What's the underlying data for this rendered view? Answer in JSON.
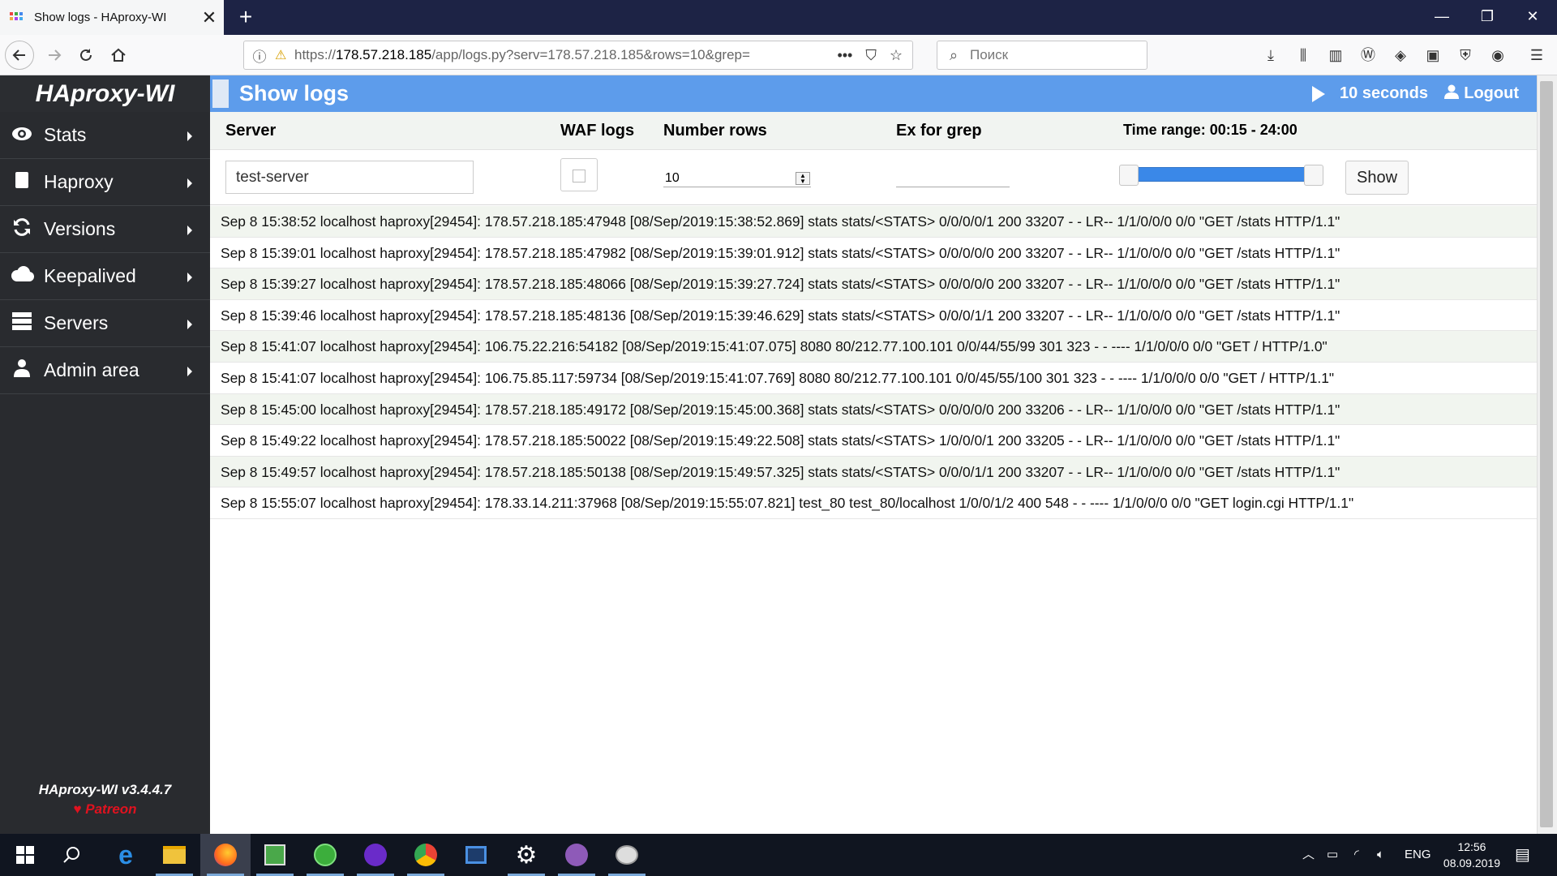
{
  "browser": {
    "tab_title": "Show logs - HAproxy-WI",
    "tab_close": "✕",
    "new_tab": "+",
    "url_prefix": "https://",
    "url_host": "178.57.218.185",
    "url_path": "/app/logs.py?serv=178.57.218.185&rows=10&grep=",
    "search_placeholder": "Поиск",
    "window_controls": {
      "minimize": "—",
      "restore": "❐",
      "close": "✕"
    }
  },
  "sidebar": {
    "logo": "HAproxy-WI",
    "items": [
      {
        "label": "Stats",
        "icon": "eye-icon"
      },
      {
        "label": "Haproxy",
        "icon": "file-icon"
      },
      {
        "label": "Versions",
        "icon": "refresh-icon"
      },
      {
        "label": "Keepalived",
        "icon": "cloud-icon"
      },
      {
        "label": "Servers",
        "icon": "server-icon"
      },
      {
        "label": "Admin area",
        "icon": "users-icon"
      }
    ],
    "version": "HAproxy-WI v3.4.4.7",
    "patreon": "Patreon"
  },
  "header": {
    "title": "Show logs",
    "refresh": "10 seconds",
    "logout": "Logout"
  },
  "filters": {
    "server_label": "Server",
    "waf_label": "WAF logs",
    "rows_label": "Number rows",
    "grep_label": "Ex for grep",
    "time_range_label": "Time range: 00:15 - 24:00",
    "server_value": "test-server",
    "rows_value": "10",
    "grep_value": "",
    "waf_checked": false,
    "time_range_fraction": [
      0.0,
      1.0
    ],
    "show_button": "Show"
  },
  "logs": [
    "Sep 8 15:38:52 localhost haproxy[29454]: 178.57.218.185:47948 [08/Sep/2019:15:38:52.869] stats stats/<STATS> 0/0/0/0/1 200 33207 - - LR-- 1/1/0/0/0 0/0 \"GET /stats HTTP/1.1\"",
    "Sep 8 15:39:01 localhost haproxy[29454]: 178.57.218.185:47982 [08/Sep/2019:15:39:01.912] stats stats/<STATS> 0/0/0/0/0 200 33207 - - LR-- 1/1/0/0/0 0/0 \"GET /stats HTTP/1.1\"",
    "Sep 8 15:39:27 localhost haproxy[29454]: 178.57.218.185:48066 [08/Sep/2019:15:39:27.724] stats stats/<STATS> 0/0/0/0/0 200 33207 - - LR-- 1/1/0/0/0 0/0 \"GET /stats HTTP/1.1\"",
    "Sep 8 15:39:46 localhost haproxy[29454]: 178.57.218.185:48136 [08/Sep/2019:15:39:46.629] stats stats/<STATS> 0/0/0/1/1 200 33207 - - LR-- 1/1/0/0/0 0/0 \"GET /stats HTTP/1.1\"",
    "Sep 8 15:41:07 localhost haproxy[29454]: 106.75.22.216:54182 [08/Sep/2019:15:41:07.075] 8080 80/212.77.100.101 0/0/44/55/99 301 323 - - ---- 1/1/0/0/0 0/0 \"GET / HTTP/1.0\"",
    "Sep 8 15:41:07 localhost haproxy[29454]: 106.75.85.117:59734 [08/Sep/2019:15:41:07.769] 8080 80/212.77.100.101 0/0/45/55/100 301 323 - - ---- 1/1/0/0/0 0/0 \"GET / HTTP/1.1\"",
    "Sep 8 15:45:00 localhost haproxy[29454]: 178.57.218.185:49172 [08/Sep/2019:15:45:00.368] stats stats/<STATS> 0/0/0/0/0 200 33206 - - LR-- 1/1/0/0/0 0/0 \"GET /stats HTTP/1.1\"",
    "Sep 8 15:49:22 localhost haproxy[29454]: 178.57.218.185:50022 [08/Sep/2019:15:49:22.508] stats stats/<STATS> 1/0/0/0/1 200 33205 - - LR-- 1/1/0/0/0 0/0 \"GET /stats HTTP/1.1\"",
    "Sep 8 15:49:57 localhost haproxy[29454]: 178.57.218.185:50138 [08/Sep/2019:15:49:57.325] stats stats/<STATS> 0/0/0/1/1 200 33207 - - LR-- 1/1/0/0/0 0/0 \"GET /stats HTTP/1.1\"",
    "Sep 8 15:55:07 localhost haproxy[29454]: 178.33.14.211:37968 [08/Sep/2019:15:55:07.821] test_80 test_80/localhost 1/0/0/1/2 400 548 - - ---- 1/1/0/0/0 0/0 \"GET login.cgi HTTP/1.1\""
  ],
  "taskbar": {
    "lang": "ENG",
    "time": "12:56",
    "date": "08.09.2019"
  },
  "colors": {
    "header_blue": "#5d9ceb",
    "sidebar_bg": "#292b2f",
    "patreon_red": "#e0121f",
    "slider_blue": "#3a88e8"
  }
}
